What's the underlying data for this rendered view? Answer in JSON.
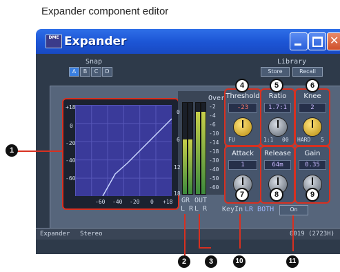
{
  "caption": "Expander component editor",
  "window": {
    "title": "Expander",
    "logo_text": "DME"
  },
  "snap": {
    "label": "Snap",
    "buttons": [
      "A",
      "B",
      "C",
      "D"
    ]
  },
  "library": {
    "label": "Library",
    "store": "Store",
    "recall": "Recall"
  },
  "graph": {
    "y_ticks": [
      "+18",
      "0",
      "-20",
      "-40",
      "-60"
    ],
    "x_ticks": [
      "-60",
      "-40",
      "-20",
      "0",
      "+18"
    ]
  },
  "meters": {
    "left_scale": [
      "0",
      "6",
      "12",
      "18"
    ],
    "over_label": "Over",
    "right_scale": [
      "-2",
      "-4",
      "-6",
      "-10",
      "-14",
      "-18",
      "-30",
      "-40",
      "-50",
      "-60"
    ],
    "gr_label": "GR",
    "out_label": "OUT",
    "lr_gr": "L R",
    "lr_out": "L R"
  },
  "controls": {
    "threshold": {
      "label": "Threshold",
      "value": "-23",
      "min_label": "FU"
    },
    "ratio": {
      "label": "Ratio",
      "value": "1.7:1",
      "min_label": "1:1",
      "max_label": "00"
    },
    "knee": {
      "label": "Knee",
      "value": "2",
      "min_label": "HARD",
      "max_label": "5"
    },
    "attack": {
      "label": "Attack",
      "value": "1"
    },
    "release": {
      "label": "Release",
      "value": "64m"
    },
    "gain": {
      "label": "Gain",
      "value": "0.35"
    }
  },
  "keyin": {
    "label": "KeyIn",
    "options": "LR BOTH",
    "button": "On"
  },
  "status": {
    "left": "Expander",
    "mode": "Stereo",
    "right": "0019 (2723H)"
  },
  "callouts": [
    "1",
    "2",
    "3",
    "4",
    "5",
    "6",
    "7",
    "8",
    "9",
    "10",
    "11"
  ],
  "colors": {
    "accent": "#d83020",
    "title_bar": "#1d56d6",
    "panel": "#56657b"
  }
}
